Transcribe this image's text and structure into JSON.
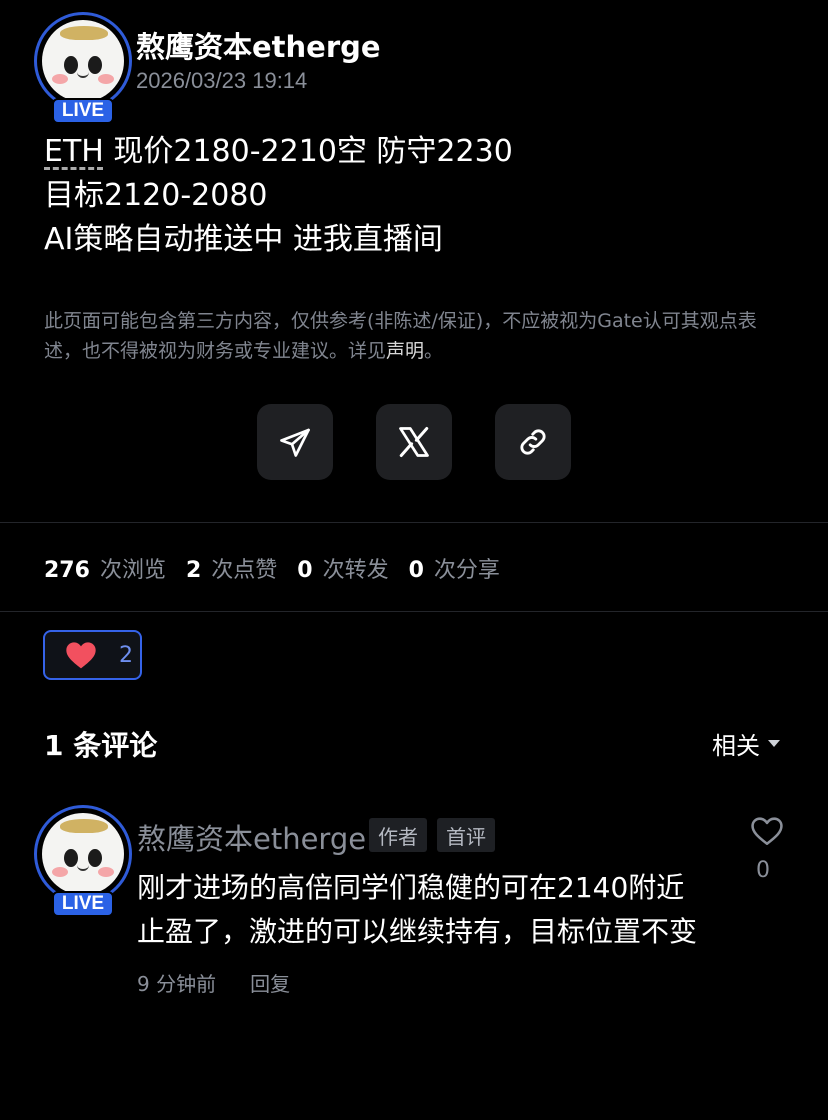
{
  "post": {
    "author": "熬鹰资本etherge",
    "live_label": "LIVE",
    "timestamp": "2026/03/23 19:14",
    "line1_ticker": "ETH",
    "line1_rest": " 现价2180-2210空  防守2230",
    "line2": "目标2120-2080",
    "line3": "AI策略自动推送中 进我直播间"
  },
  "disclaimer": {
    "text": "此页面可能包含第三方内容，仅供参考(非陈述/保证)，不应被视为Gate认可其观点表述，也不得被视为财务或专业建议。详见",
    "link": "声明",
    "end": "。"
  },
  "share": {
    "icons": [
      "send-icon",
      "x-logo-icon",
      "link-icon"
    ]
  },
  "stats": {
    "views_num": "276",
    "views_label": "次浏览",
    "likes_num": "2",
    "likes_label": "次点赞",
    "reposts_num": "0",
    "reposts_label": "次转发",
    "shares_num": "0",
    "shares_label": "次分享"
  },
  "like_button": {
    "count": "2"
  },
  "comments": {
    "title": "1 条评论",
    "sort_label": "相关",
    "items": [
      {
        "author": "熬鹰资本etherge",
        "live_label": "LIVE",
        "tag_author": "作者",
        "tag_first": "首评",
        "line1": "刚才进场的高倍同学们稳健的可在2140附近",
        "line2": "止盈了，激进的可以继续持有，目标位置不变",
        "time": "9 分钟前",
        "reply_label": "回复",
        "like_count": "0"
      }
    ]
  },
  "colors": {
    "background": "#000000",
    "accent_blue": "#2b62e6",
    "like_red": "#f2505f",
    "muted_text": "#8a8f99"
  }
}
